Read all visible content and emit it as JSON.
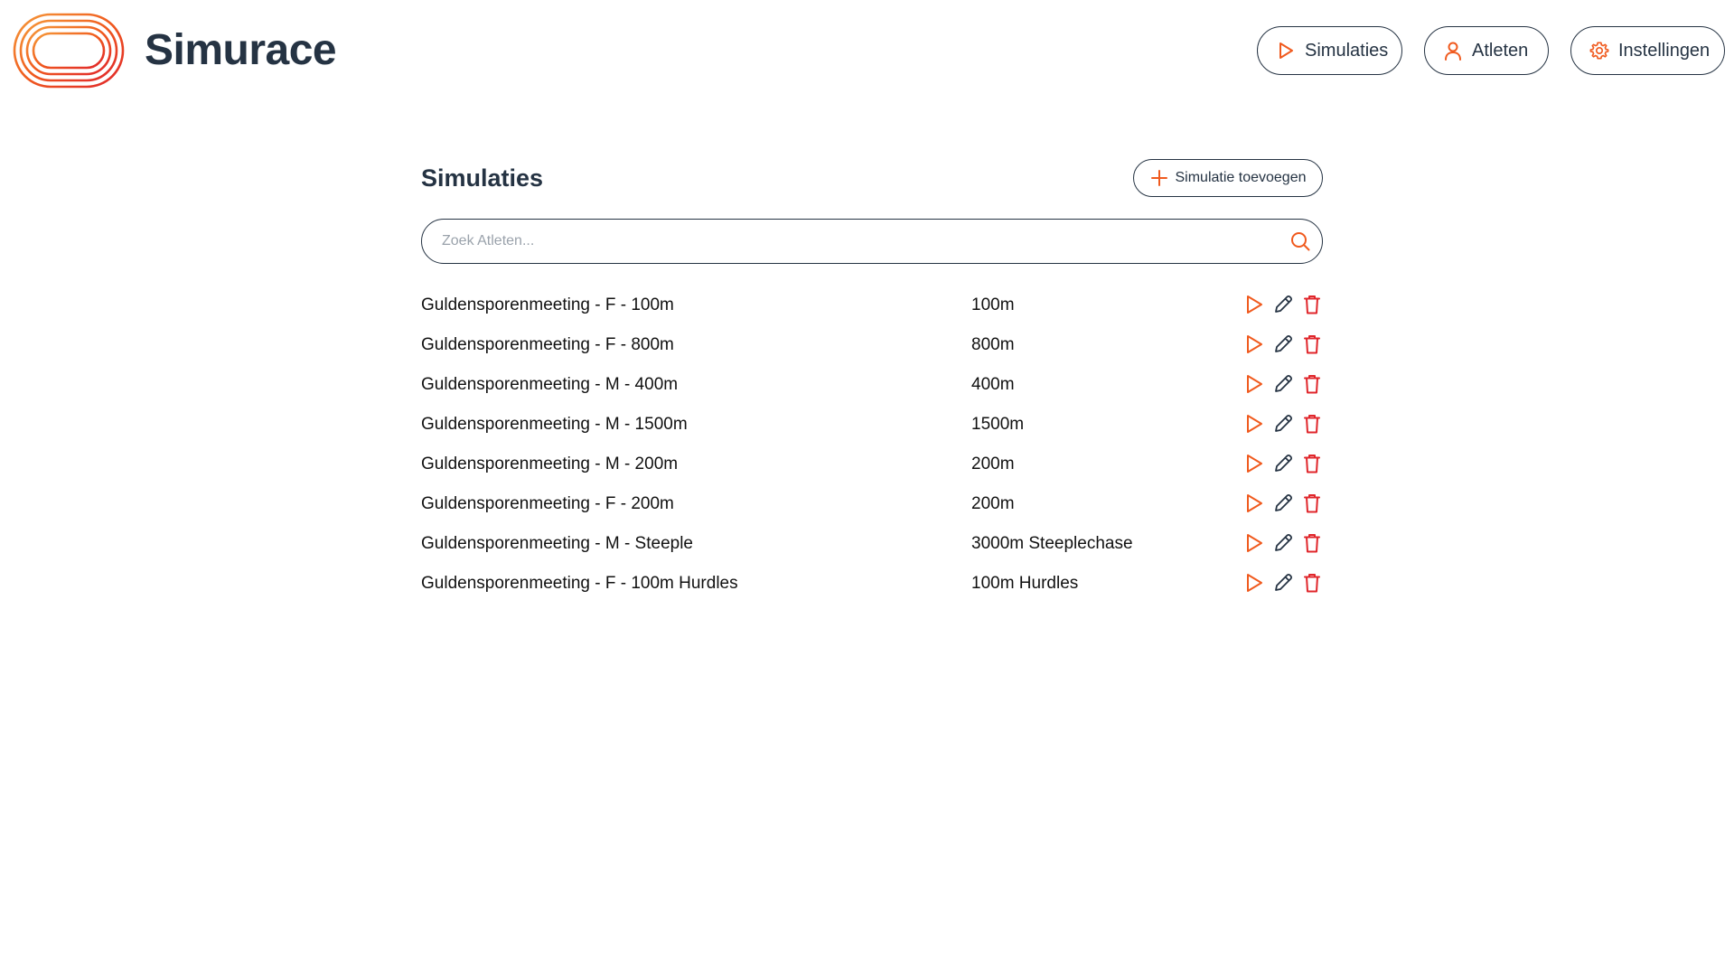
{
  "brand": {
    "name": "Simurace"
  },
  "nav": {
    "simulaties": "Simulaties",
    "atleten": "Atleten",
    "instellingen": "Instellingen"
  },
  "main": {
    "title": "Simulaties",
    "add_label": "Simulatie toevoegen",
    "search_placeholder": "Zoek Atleten..."
  },
  "simulations": [
    {
      "name": "Guldensporenmeeting - F - 100m",
      "distance": "100m"
    },
    {
      "name": "Guldensporenmeeting - F - 800m",
      "distance": "800m"
    },
    {
      "name": "Guldensporenmeeting - M - 400m",
      "distance": "400m"
    },
    {
      "name": "Guldensporenmeeting - M - 1500m",
      "distance": "1500m"
    },
    {
      "name": "Guldensporenmeeting - M - 200m",
      "distance": "200m"
    },
    {
      "name": "Guldensporenmeeting - F - 200m",
      "distance": "200m"
    },
    {
      "name": "Guldensporenmeeting - M - Steeple",
      "distance": "3000m Steeplechase"
    },
    {
      "name": "Guldensporenmeeting - F - 100m Hurdles",
      "distance": "100m Hurdles"
    }
  ],
  "colors": {
    "accent": "#f05a1e",
    "dark": "#253343",
    "delete": "#e0262b"
  },
  "icons": {
    "play": "play-icon",
    "edit": "pencil-icon",
    "delete": "trash-icon",
    "user": "user-icon",
    "settings": "gear-icon",
    "add": "plus-icon",
    "search": "search-icon"
  }
}
